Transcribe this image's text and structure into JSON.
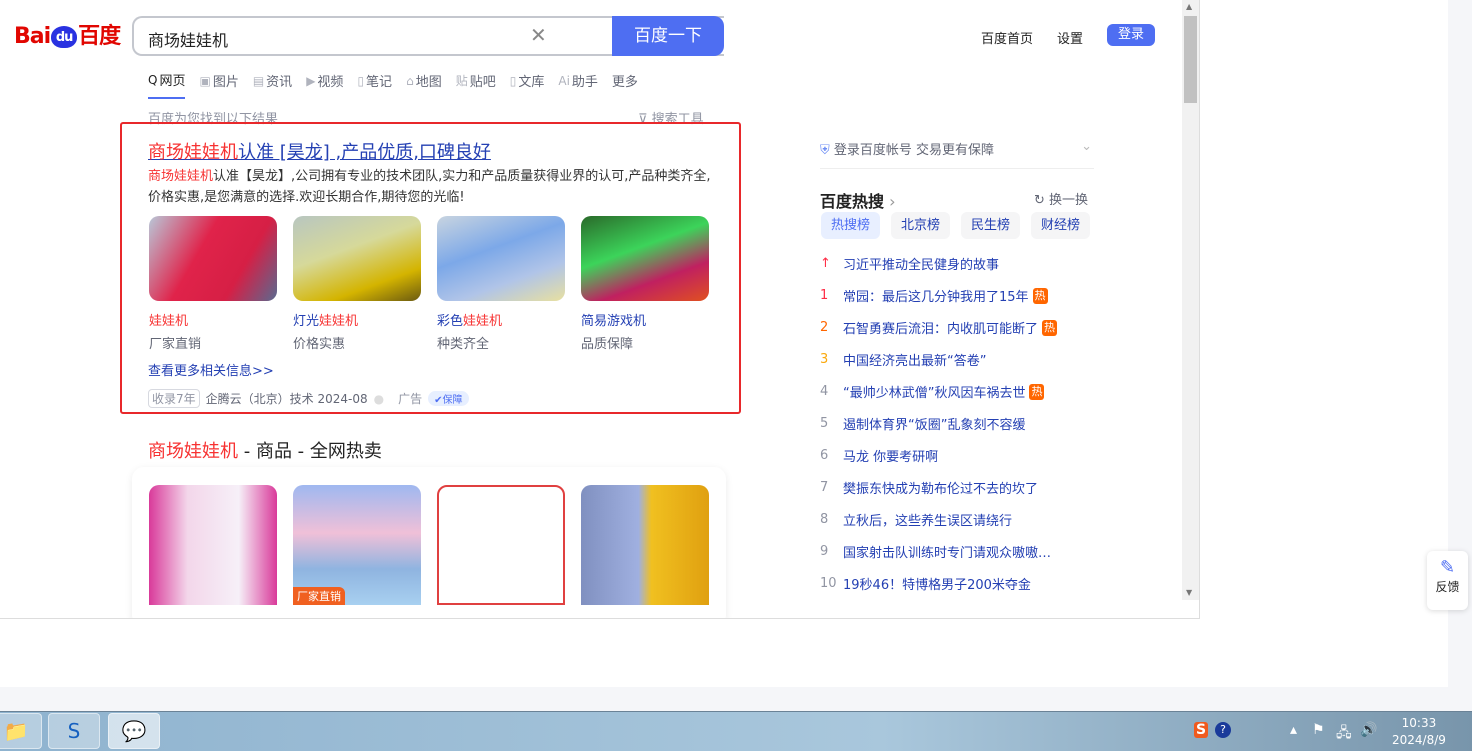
{
  "header": {
    "logo": "百度",
    "query": "商场娃娃机",
    "search_button": "百度一下",
    "links": [
      "百度首页",
      "设置"
    ],
    "login": "登录"
  },
  "tabs": [
    {
      "label": "网页",
      "icon": "search-icon"
    },
    {
      "label": "图片",
      "icon": "image-icon"
    },
    {
      "label": "资讯",
      "icon": "news-icon"
    },
    {
      "label": "视频",
      "icon": "video-icon"
    },
    {
      "label": "笔记",
      "icon": "note-icon"
    },
    {
      "label": "地图",
      "icon": "map-icon"
    },
    {
      "label": "贴吧",
      "icon": "tieba-icon"
    },
    {
      "label": "文库",
      "icon": "doc-icon"
    },
    {
      "label": "助手",
      "icon": "ai-icon"
    },
    {
      "label": "更多"
    }
  ],
  "results_info": "百度为您找到以下结果",
  "search_tools": "搜索工具",
  "ad": {
    "title_red": "商场娃娃机",
    "title_rest": "认准 [昊龙] ,产品优质,口碑良好",
    "desc_red": "商场娃娃机",
    "desc_rest": "认准【昊龙】,公司拥有专业的技术团队,实力和产品质量获得业界的认可,产品种类齐全,价格实惠,是您满意的选择.欢迎长期合作,期待您的光临!",
    "items": [
      {
        "pre": "",
        "red": "娃娃机",
        "sub": "厂家直销"
      },
      {
        "pre": "灯光",
        "red": "娃娃机",
        "sub": "价格实惠"
      },
      {
        "pre": "彩色",
        "red": "娃娃机",
        "sub": "种类齐全"
      },
      {
        "pre": "简易游戏机",
        "red": "",
        "sub": "品质保障"
      }
    ],
    "more": "查看更多相关信息>>",
    "badge": "收录7年",
    "company": "企腾云（北京）技术 2024-08",
    "ad_label": "广告",
    "guarantee": "保障"
  },
  "products": {
    "title_red": "商场娃娃机",
    "title_rest": " - 商品 - 全网热卖",
    "tag": "厂家直销"
  },
  "sidebar": {
    "account": "登录百度帐号 交易更有保障",
    "hot_title": "百度热搜",
    "refresh": "换一换",
    "tabs": [
      "热搜榜",
      "北京榜",
      "民生榜",
      "财经榜"
    ],
    "items": [
      {
        "rank": "↑",
        "text": "习近平推动全民健身的故事",
        "hot": ""
      },
      {
        "rank": "1",
        "text": "常园：最后这几分钟我用了15年",
        "hot": "热"
      },
      {
        "rank": "2",
        "text": "石智勇赛后流泪：内收肌可能断了",
        "hot": "热"
      },
      {
        "rank": "3",
        "text": "中国经济亮出最新“答卷”",
        "hot": ""
      },
      {
        "rank": "4",
        "text": "“最帅少林武僧”秋风因车祸去世",
        "hot": "热"
      },
      {
        "rank": "5",
        "text": "遏制体育界“饭圈”乱象刻不容缓",
        "hot": ""
      },
      {
        "rank": "6",
        "text": "马龙 你要考研啊",
        "hot": ""
      },
      {
        "rank": "7",
        "text": "樊振东快成为勒布伦过不去的坎了",
        "hot": ""
      },
      {
        "rank": "8",
        "text": "立秋后，这些养生误区请绕行",
        "hot": ""
      },
      {
        "rank": "9",
        "text": "国家射击队训练时专门请观众嗷嗷…",
        "hot": ""
      },
      {
        "rank": "10",
        "text": "19秒46！特博格男子200米夺金",
        "hot": ""
      }
    ],
    "rank_colors": {
      "1": "#fe2d46",
      "2": "#f60",
      "3": "#faa90e",
      "top": "#fe2d46"
    }
  },
  "feedback": "反馈",
  "taskbar": {
    "time": "10:33",
    "date": "2024/8/9"
  }
}
